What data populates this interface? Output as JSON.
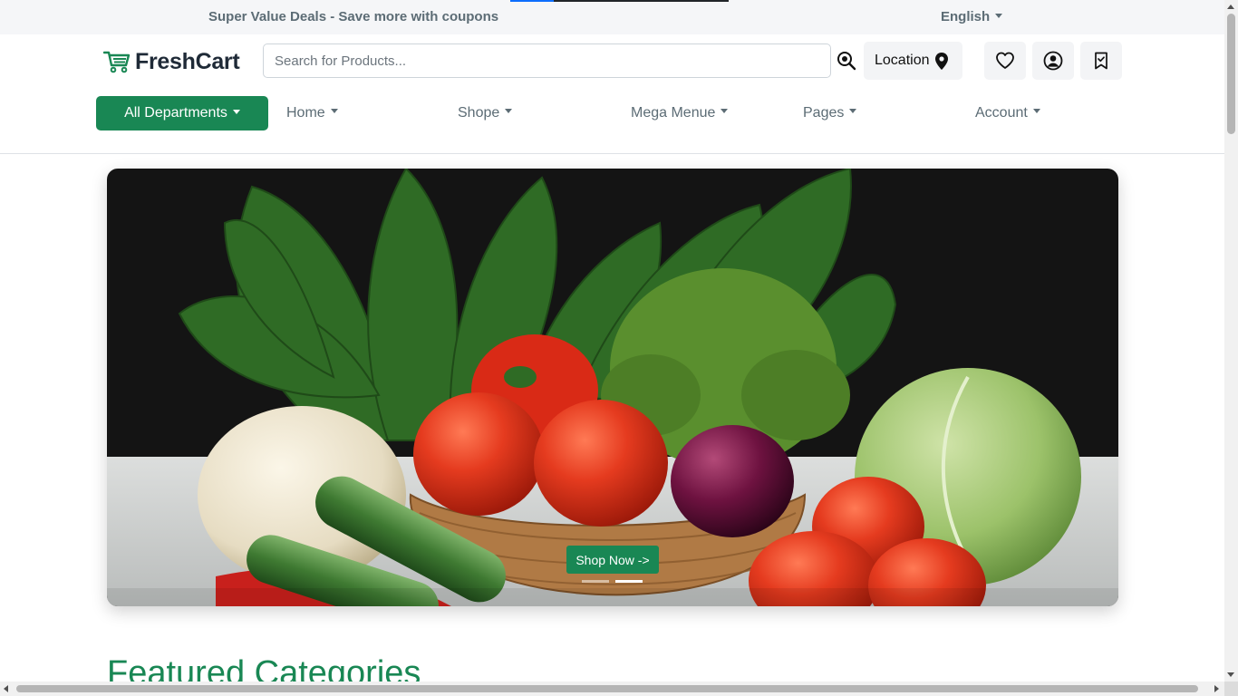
{
  "topbar": {
    "promo": "Super Value Deals - Save more with coupons",
    "language": "English"
  },
  "brand": {
    "name": "FreshCart",
    "icon": "cart-icon",
    "color": "#198754"
  },
  "search": {
    "placeholder": "Search for Products...",
    "value": "",
    "icon": "search-icon"
  },
  "header_actions": {
    "location_label": "Location",
    "location_icon": "map-pin-icon",
    "wishlist_icon": "heart-icon",
    "account_icon": "user-circle-icon",
    "bookmark_icon": "bookmark-check-icon"
  },
  "nav": {
    "departments_label": "All Departments",
    "items": [
      {
        "label": "Home"
      },
      {
        "label": "Shope"
      },
      {
        "label": "Mega Menue"
      },
      {
        "label": "Pages"
      },
      {
        "label": "Account"
      }
    ]
  },
  "hero": {
    "cta_label": "Shop Now ->",
    "slides": 2,
    "active_slide": 2
  },
  "featured": {
    "title": "Featured Categories"
  },
  "colors": {
    "accent": "#198754",
    "topbar_bg": "#f5f6f8",
    "nav_text": "#5c6c75"
  }
}
